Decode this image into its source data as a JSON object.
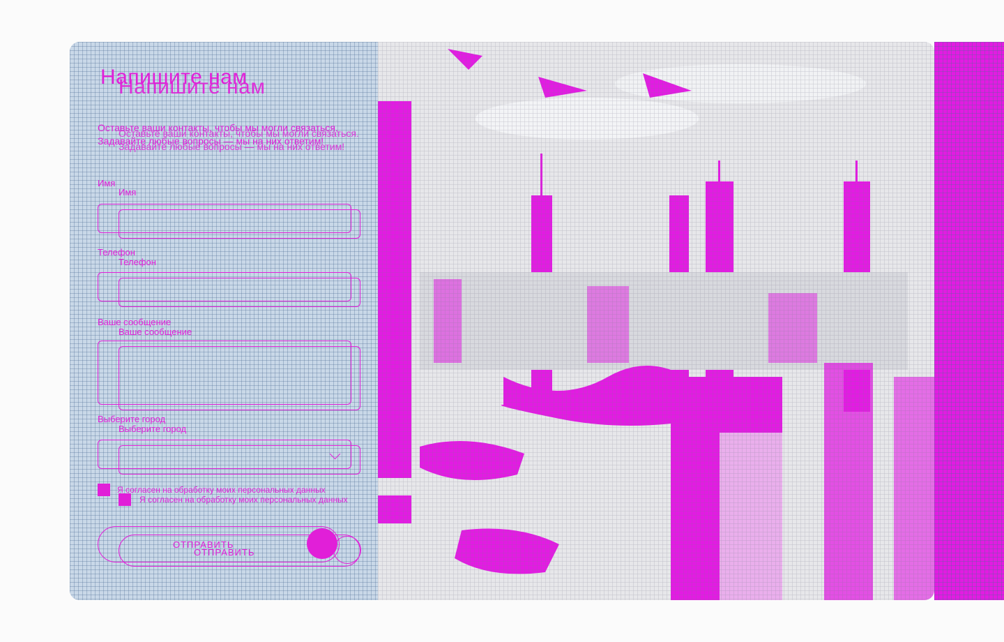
{
  "form": {
    "title": "Напишите нам",
    "description": "Оставьте ваши контакты, чтобы мы могли связаться. Задавайте любые вопросы — мы на них ответим!",
    "fields": {
      "name_label": "Имя",
      "phone_label": "Телефон",
      "message_label": "Ваше сообщение",
      "city_label": "Выберите город"
    },
    "consent_label": "Я согласен на обработку моих персональных данных",
    "submit_label": "ОТПРАВИТЬ"
  },
  "colors": {
    "accent": "#e11fd8",
    "panel": "#c9d8e8",
    "photo_bg": "#e7e7ea"
  },
  "icons": {
    "submit_circle": "arrow-circle-icon",
    "city_chevron": "chevron-down-icon"
  },
  "photo": {
    "subject": "city-skyline-photo"
  }
}
